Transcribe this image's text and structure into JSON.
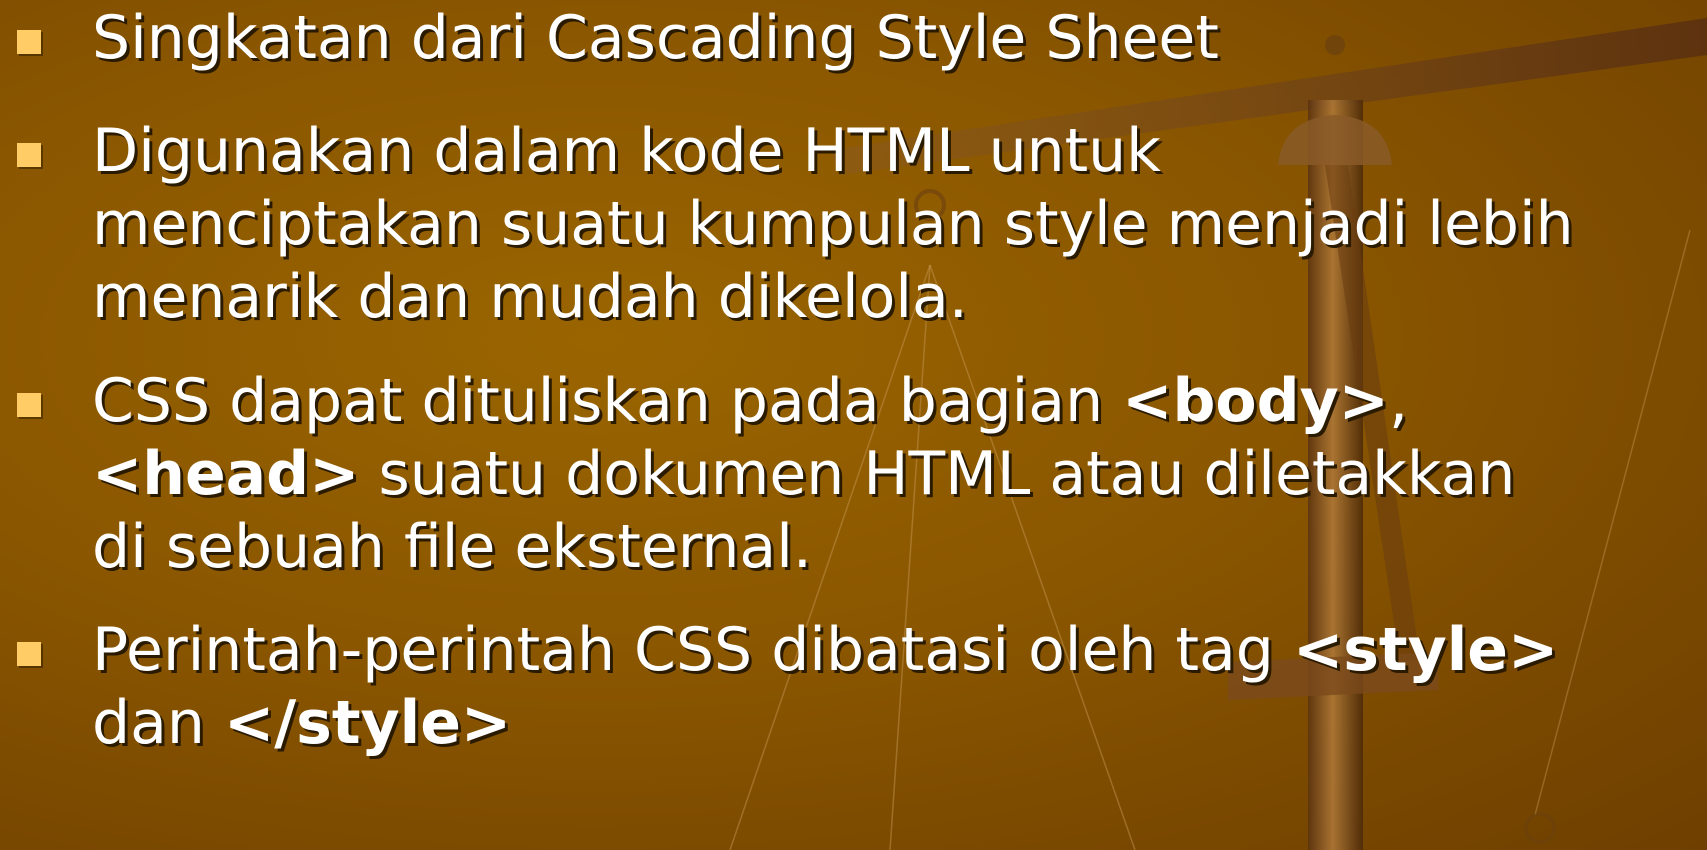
{
  "colors": {
    "background": "#8a5600",
    "bullet_marker": "#ffcc66",
    "text": "#ffffff"
  },
  "bullets": [
    {
      "lines": [
        [
          "Singkatan dari Cascading Style Sheet"
        ]
      ]
    },
    {
      "lines": [
        [
          "Digunakan dalam kode HTML untuk"
        ],
        [
          "menciptakan suatu kumpulan style menjadi lebih"
        ],
        [
          "menarik dan mudah dikelola."
        ]
      ]
    },
    {
      "lines": [
        [
          "CSS dapat dituliskan pada bagian ",
          "<body>",
          ","
        ],
        [
          "<head>",
          " suatu dokumen HTML atau diletakkan"
        ],
        [
          "di sebuah file eksternal."
        ]
      ]
    },
    {
      "lines": [
        [
          "Perintah-perintah CSS dibatasi oleh tag ",
          "<style>"
        ],
        [
          "dan ",
          "</style>"
        ]
      ]
    }
  ]
}
